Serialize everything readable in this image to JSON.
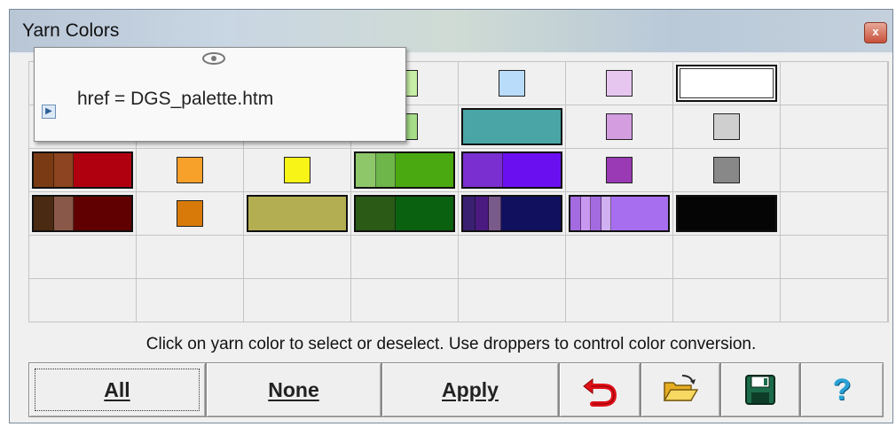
{
  "window": {
    "title": "Yarn Colors",
    "close_glyph": "x"
  },
  "tooltip": {
    "text": "href = DGS_palette.htm",
    "eye_icon": "eye-icon",
    "play_glyph": "▶"
  },
  "palette": {
    "rows": [
      [
        {
          "type": "hidden"
        },
        {
          "type": "hidden"
        },
        {
          "type": "hidden"
        },
        {
          "type": "swatch",
          "color": "#c8efa6"
        },
        {
          "type": "swatch",
          "color": "#b9dcfa"
        },
        {
          "type": "swatch",
          "color": "#e6c6ef"
        },
        {
          "type": "bar-white",
          "color": "#ffffff"
        },
        {
          "type": "empty"
        }
      ],
      [
        {
          "type": "swatch",
          "color": "#e89a94"
        },
        {
          "type": "swatch",
          "color": "#f4b660"
        },
        {
          "type": "swatch",
          "color": "#f6f07a"
        },
        {
          "type": "swatch",
          "color": "#a6dd88"
        },
        {
          "type": "bar",
          "colors": [
            "#4aa6a6"
          ],
          "weights": [
            1
          ]
        },
        {
          "type": "swatch",
          "color": "#d39ddf"
        },
        {
          "type": "swatch",
          "color": "#cfcfcf"
        },
        {
          "type": "empty"
        }
      ],
      [
        {
          "type": "bar",
          "colors": [
            "#7a3b14",
            "#8c4520",
            "#b00010"
          ],
          "weights": [
            1,
            1,
            3
          ]
        },
        {
          "type": "swatch",
          "color": "#f7a02a"
        },
        {
          "type": "swatch",
          "color": "#f8f418"
        },
        {
          "type": "bar",
          "colors": [
            "#8ec66a",
            "#6eb54a",
            "#4aa810"
          ],
          "weights": [
            1,
            1,
            3
          ]
        },
        {
          "type": "bar",
          "colors": [
            "#7a2fd0",
            "#6a10f0"
          ],
          "weights": [
            2,
            3
          ]
        },
        {
          "type": "swatch",
          "color": "#9a3ab4"
        },
        {
          "type": "swatch",
          "color": "#888888"
        },
        {
          "type": "empty"
        }
      ],
      [
        {
          "type": "bar",
          "colors": [
            "#4a2a12",
            "#8a5848",
            "#600000"
          ],
          "weights": [
            1,
            1,
            3
          ]
        },
        {
          "type": "swatch",
          "color": "#d87a0a"
        },
        {
          "type": "bar",
          "colors": [
            "#b4ae52"
          ],
          "weights": [
            1
          ]
        },
        {
          "type": "bar",
          "colors": [
            "#2a5a16",
            "#0a6210"
          ],
          "weights": [
            2,
            3
          ]
        },
        {
          "type": "bar",
          "colors": [
            "#3a2070",
            "#4a1a80",
            "#7a5a8a",
            "#10105e"
          ],
          "weights": [
            1,
            1,
            1,
            5
          ]
        },
        {
          "type": "bar",
          "colors": [
            "#a46ae0",
            "#c898f0",
            "#a46ae0",
            "#d0b0f0",
            "#a86ef0"
          ],
          "weights": [
            1,
            1,
            1,
            1,
            6
          ]
        },
        {
          "type": "bar",
          "colors": [
            "#050505"
          ],
          "weights": [
            1
          ]
        },
        {
          "type": "empty"
        }
      ],
      [
        {
          "type": "empty"
        },
        {
          "type": "empty"
        },
        {
          "type": "empty"
        },
        {
          "type": "empty"
        },
        {
          "type": "empty"
        },
        {
          "type": "empty"
        },
        {
          "type": "empty"
        },
        {
          "type": "empty"
        }
      ],
      [
        {
          "type": "empty"
        },
        {
          "type": "empty"
        },
        {
          "type": "empty"
        },
        {
          "type": "empty"
        },
        {
          "type": "empty"
        },
        {
          "type": "empty"
        },
        {
          "type": "empty"
        },
        {
          "type": "empty"
        }
      ]
    ]
  },
  "instructions": "Click on yarn color to select or deselect. Use droppers to control color conversion.",
  "buttons": {
    "all": "All",
    "none": "None",
    "apply": "Apply",
    "undo_icon": "undo-arrow-icon",
    "open_icon": "open-folder-icon",
    "save_icon": "floppy-disk-icon",
    "help_glyph": "?"
  },
  "colors": {
    "undo_red": "#e0101a",
    "folder_yellow": "#f2c530",
    "floppy_green": "#1c6b4a",
    "help_blue": "#2aa2d6"
  }
}
